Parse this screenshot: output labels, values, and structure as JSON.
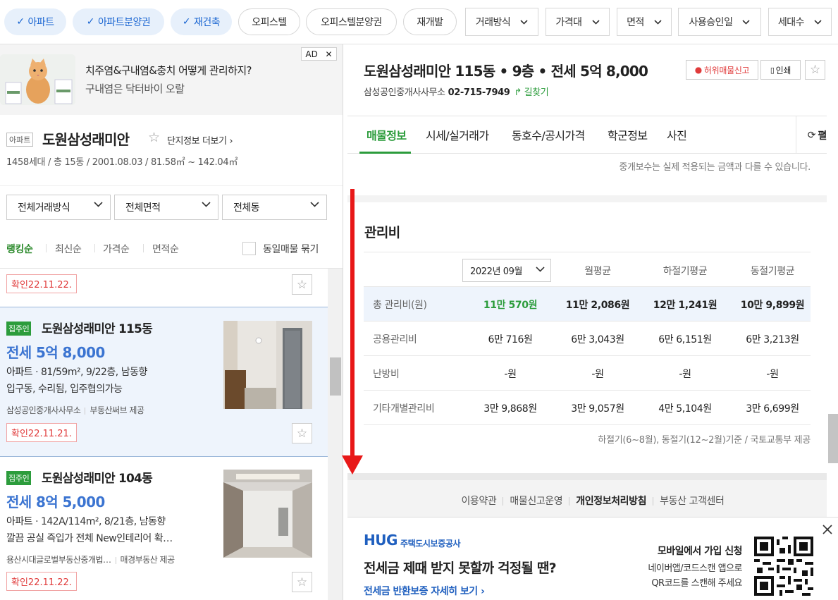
{
  "filters": {
    "chips": [
      {
        "label": "아파트",
        "active": true
      },
      {
        "label": "아파트분양권",
        "active": true
      },
      {
        "label": "재건축",
        "active": true
      },
      {
        "label": "오피스텔",
        "active": false
      },
      {
        "label": "오피스텔분양권",
        "active": false
      },
      {
        "label": "재개발",
        "active": false
      }
    ],
    "dropdowns": [
      "거래방식",
      "가격대",
      "면적",
      "사용승인일",
      "세대수"
    ]
  },
  "ad": {
    "tag": "AD",
    "line1": "치주염&구내염&충치 어떻게 관리하지?",
    "line2": "구내염은 닥터바이 오랄"
  },
  "complex": {
    "type": "아파트",
    "name": "도원삼성래미안",
    "more_link": "단지정보 더보기",
    "info": "1458세대 / 총 15동 / 2001.08.03 / 81.58㎡ ~ 142.04㎡"
  },
  "list_filters": [
    "전체거래방식",
    "전체면적",
    "전체동"
  ],
  "sort": {
    "options": [
      "랭킹순",
      "최신순",
      "가격순",
      "면적순"
    ],
    "active": "랭킹순",
    "group_label": "동일매물 묶기"
  },
  "listings": [
    {
      "confirm": "확인22.11.22."
    },
    {
      "badge": "집주인",
      "name": "도원삼성래미안 115동",
      "price": "전세 5억 8,000",
      "spec_type": "아파트",
      "spec": "· 81/59m², 9/22층, 남동향",
      "desc": "입구동, 수리됨, 입주협의가능",
      "agent": "삼성공인중개사사무소",
      "provider": "부동산써브 제공",
      "confirm": "확인22.11.21."
    },
    {
      "badge": "집주인",
      "name": "도원삼성래미안 104동",
      "price": "전세 8억 5,000",
      "spec_type": "아파트",
      "spec": "· 142A/114m², 8/21층, 남동향",
      "desc": "깔끔 공실 즉입가 전체 New인테리어 확…",
      "agent": "용산시대글로벌부동산중개법…",
      "provider": "매경부동산 제공",
      "confirm": "확인22.11.22."
    }
  ],
  "detail": {
    "title": "도원삼성래미안 115동 • 9층 • 전세 5억 8,000",
    "agent": "삼성공인중개사사무소",
    "phone": "02-715-7949",
    "route": "길찾기",
    "report_btn": "허위매물신고",
    "print_btn": "인쇄",
    "tabs": [
      "매물정보",
      "시세/실거래가",
      "동호수/공시가격",
      "학군정보",
      "사진"
    ],
    "active_tab": "매물정보",
    "refresh": "펼",
    "fee_note": "중개보수는 실제 적용되는 금액과 다를 수 있습니다.",
    "section_title": "관리비",
    "month_select": "2022년 09월",
    "headers": [
      "월평균",
      "하절기평균",
      "동절기평균"
    ],
    "rows": [
      {
        "label": "총 관리비(원)",
        "values": [
          "11만 570원",
          "11만 2,086원",
          "12만 1,241원",
          "10만 9,899원"
        ]
      },
      {
        "label": "공용관리비",
        "values": [
          "6만 716원",
          "6만 3,043원",
          "6만 6,151원",
          "6만 3,213원"
        ]
      },
      {
        "label": "난방비",
        "values": [
          "-원",
          "-원",
          "-원",
          "-원"
        ]
      },
      {
        "label": "기타개별관리비",
        "values": [
          "3만 9,868원",
          "3만 9,057원",
          "4만 5,104원",
          "3만 6,699원"
        ]
      }
    ],
    "source_note": "하절기(6~8월), 동절기(12~2월)기준 / 국토교통부 제공",
    "footer_links": [
      "이용약관",
      "매물신고운영",
      "개인정보처리방침",
      "부동산 고객센터"
    ]
  },
  "hug": {
    "logo": "HUG",
    "logo_sub": "주택도시보증공사",
    "headline": "전세금 제때 받지 못할까 걱정될 땐?",
    "link": "전세금 반환보증 자세히 보기",
    "right1": "모바일에서 가입 신청",
    "right2": "네이버앱/코드스캔 앱으로",
    "right3": "QR코드를 스캔해 주세요"
  },
  "colors": {
    "accent_green": "#2c9c3c",
    "price_blue": "#3b74d1",
    "chip_blue": "#1b66d2",
    "annotation_red": "#e81818"
  }
}
